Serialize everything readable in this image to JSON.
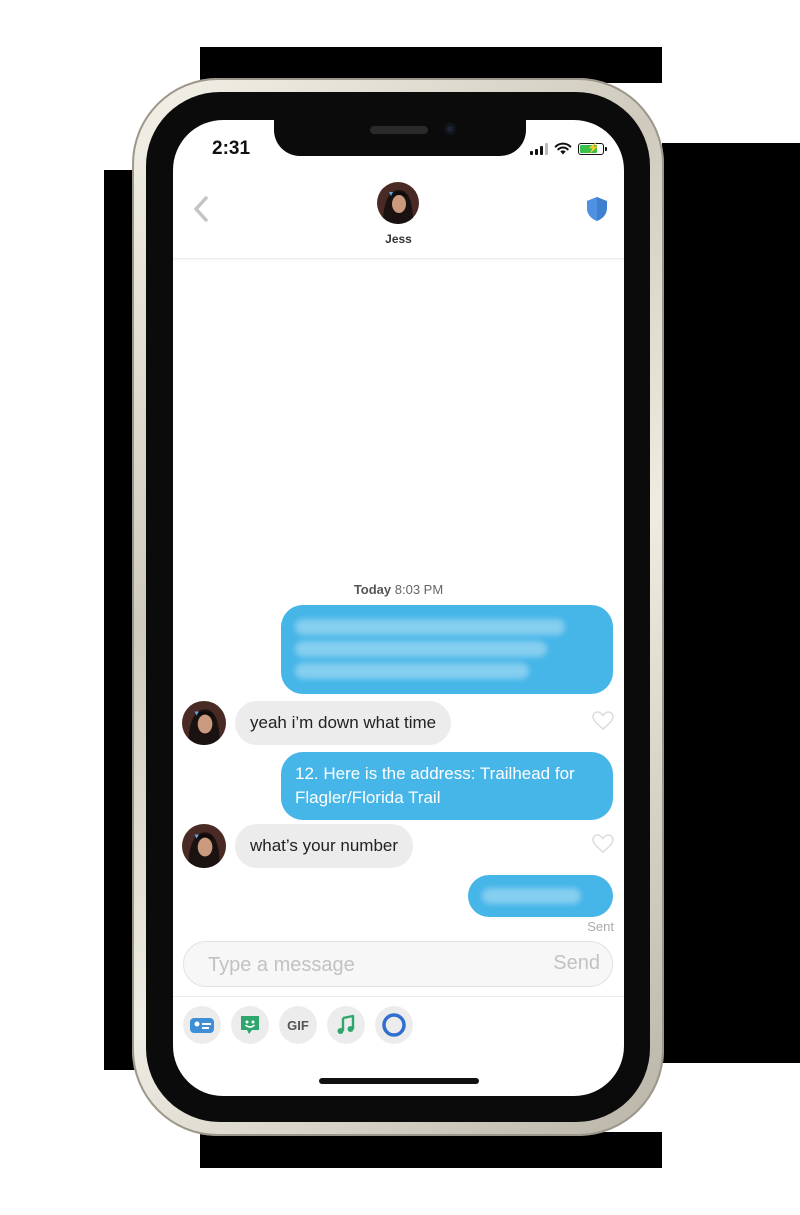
{
  "status_bar": {
    "time": "2:31"
  },
  "header": {
    "contact_name": "Jess"
  },
  "conversation": {
    "timestamp_day": "Today",
    "timestamp_time": "8:03 PM",
    "messages": [
      {
        "from": "me",
        "text": "",
        "redacted": true
      },
      {
        "from": "them",
        "text": "yeah i’m down what time"
      },
      {
        "from": "me",
        "text": "12. Here is the address: Trailhead for Flagler/Florida Trail"
      },
      {
        "from": "them",
        "text": "what’s your number"
      },
      {
        "from": "me",
        "text": "",
        "redacted": true
      }
    ],
    "delivery_status": "Sent"
  },
  "composer": {
    "placeholder": "Type a message",
    "send_label": "Send"
  },
  "toolbar": {
    "gif_label": "GIF"
  },
  "colors": {
    "sent_bubble": "#46b5e8",
    "received_bubble": "#ececec",
    "shield": "#3f7fd0"
  },
  "icons": [
    "back-chevron-icon",
    "shield-icon",
    "heart-icon",
    "contact-card-icon",
    "sticker-icon",
    "gif-icon",
    "music-icon",
    "circle-icon"
  ]
}
